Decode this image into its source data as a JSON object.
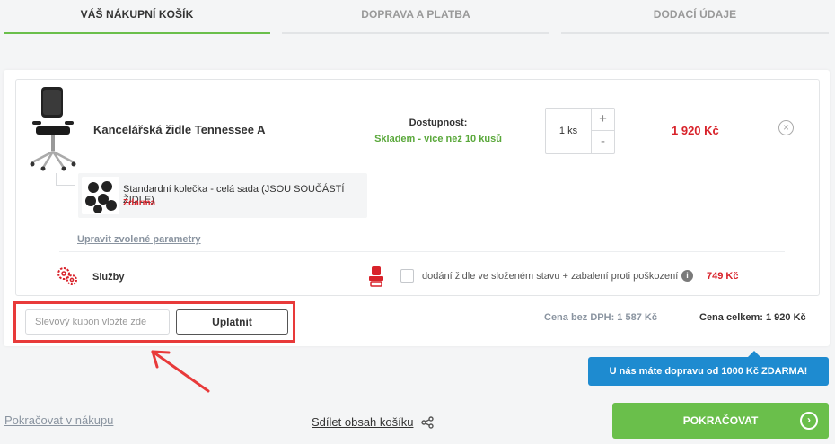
{
  "steps": [
    {
      "label": "VÁŠ NÁKUPNÍ KOŠÍK",
      "active": true
    },
    {
      "label": "DOPRAVA A PLATBA",
      "active": false
    },
    {
      "label": "DODACÍ ÚDAJE",
      "active": false
    }
  ],
  "item": {
    "name": "Kancelářská židle Tennessee A",
    "availability_label": "Dostupnost:",
    "availability_value": "Skladem - více než 10 kusů",
    "quantity": "1 ks",
    "price": "1 920 Kč",
    "accessory": {
      "name": "Standardní kolečka - celá sada (JSOU SOUČÁSTÍ ŽIDLE)",
      "price": "Zdarma"
    },
    "edit_params": "Upravit zvolené parametry"
  },
  "services": {
    "label": "Služby",
    "option_text": "dodání židle ve složeném stavu + zabalení proti poškození",
    "option_price": "749 Kč"
  },
  "coupon": {
    "placeholder": "Slevový kupon vložte zde",
    "button": "Uplatnit"
  },
  "summary": {
    "net_label": "Cena bez DPH: 1 587 Kč",
    "total_label": "Cena celkem: 1 920 Kč"
  },
  "delivery_note": "U nás máte dopravu od 1000 Kč ZDARMA!",
  "footer": {
    "continue_shopping": "Pokračovat v nákupu",
    "share_cart": "Sdílet obsah košíku",
    "next_button": "POKRAČOVAT"
  },
  "colors": {
    "accent_green": "#6abf4b",
    "price_red": "#d8222a",
    "highlight_red": "#e83a3a",
    "info_blue": "#1e8bd0"
  }
}
